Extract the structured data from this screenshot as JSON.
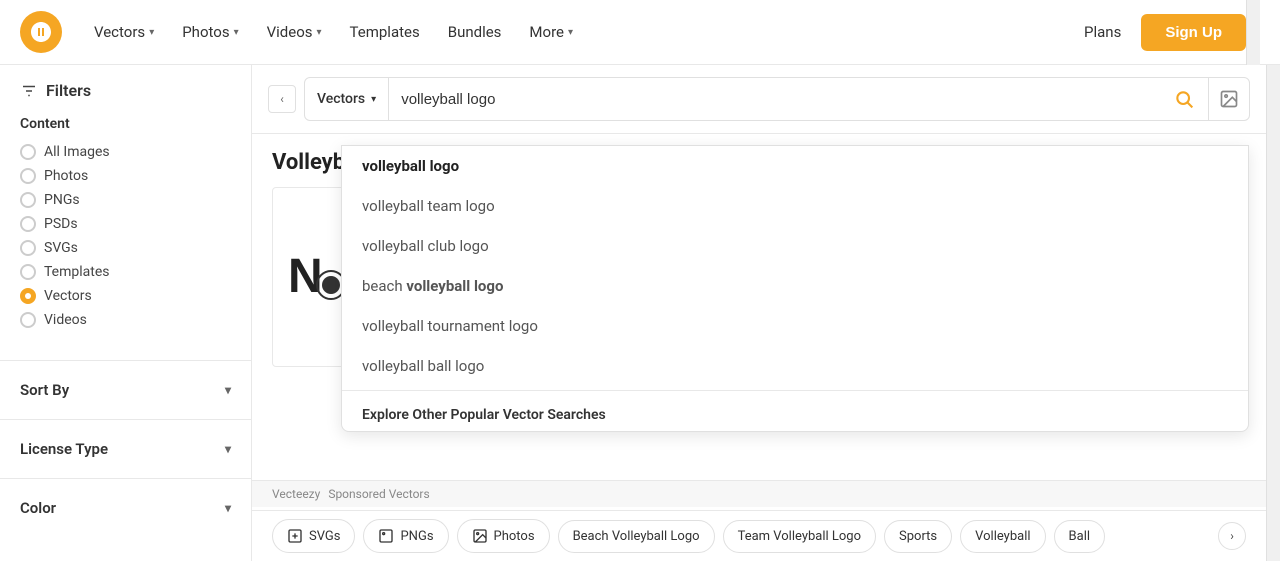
{
  "header": {
    "logo_alt": "Vecteezy Logo",
    "nav": [
      {
        "label": "Vectors",
        "has_dropdown": true
      },
      {
        "label": "Photos",
        "has_dropdown": true
      },
      {
        "label": "Videos",
        "has_dropdown": true
      },
      {
        "label": "Templates",
        "has_dropdown": false
      },
      {
        "label": "Bundles",
        "has_dropdown": false
      },
      {
        "label": "More",
        "has_dropdown": true
      }
    ],
    "plans_label": "Plans",
    "signup_label": "Sign Up"
  },
  "search": {
    "type_label": "Vectors",
    "input_value": "volleyball logo",
    "suggestions": [
      {
        "text": "volleyball logo",
        "bold": true,
        "bold_part": ""
      },
      {
        "text": "volleyball team logo",
        "bold": false,
        "bold_part": ""
      },
      {
        "text": "volleyball club logo",
        "bold": false,
        "bold_part": ""
      },
      {
        "text": "beach volleyball logo",
        "bold": false,
        "bold_part": "volleyball logo",
        "prefix": "beach "
      },
      {
        "text": "volleyball tournament logo",
        "bold": false,
        "bold_part": ""
      },
      {
        "text": "volleyball ball logo",
        "bold": false,
        "bold_part": ""
      }
    ],
    "explore_title": "Explore Other Popular Vector Searches"
  },
  "sidebar": {
    "filters_label": "Filters",
    "content_section": {
      "title": "Content",
      "options": [
        {
          "label": "All Images",
          "selected": false
        },
        {
          "label": "Photos",
          "selected": false
        },
        {
          "label": "PNGs",
          "selected": false
        },
        {
          "label": "PSDs",
          "selected": false
        },
        {
          "label": "SVGs",
          "selected": false
        },
        {
          "label": "Templates",
          "selected": false
        },
        {
          "label": "Vectors",
          "selected": true
        },
        {
          "label": "Videos",
          "selected": false
        }
      ]
    },
    "sort_by_label": "Sort By",
    "license_type_label": "License Type",
    "color_label": "Color"
  },
  "page": {
    "title": "Volleyball Log",
    "sponsored_label": "Vecteezy",
    "sponsored_vectors_label": "Sponsored Vectors"
  },
  "chips": [
    {
      "label": "SVGs",
      "icon": "svg-icon"
    },
    {
      "label": "PNGs",
      "icon": "png-icon"
    },
    {
      "label": "Photos",
      "icon": "photo-icon"
    },
    {
      "label": "Beach Volleyball Logo",
      "icon": null
    },
    {
      "label": "Team Volleyball Logo",
      "icon": null
    },
    {
      "label": "Sports",
      "icon": null
    },
    {
      "label": "Volleyball",
      "icon": null
    },
    {
      "label": "Ball",
      "icon": null
    }
  ]
}
